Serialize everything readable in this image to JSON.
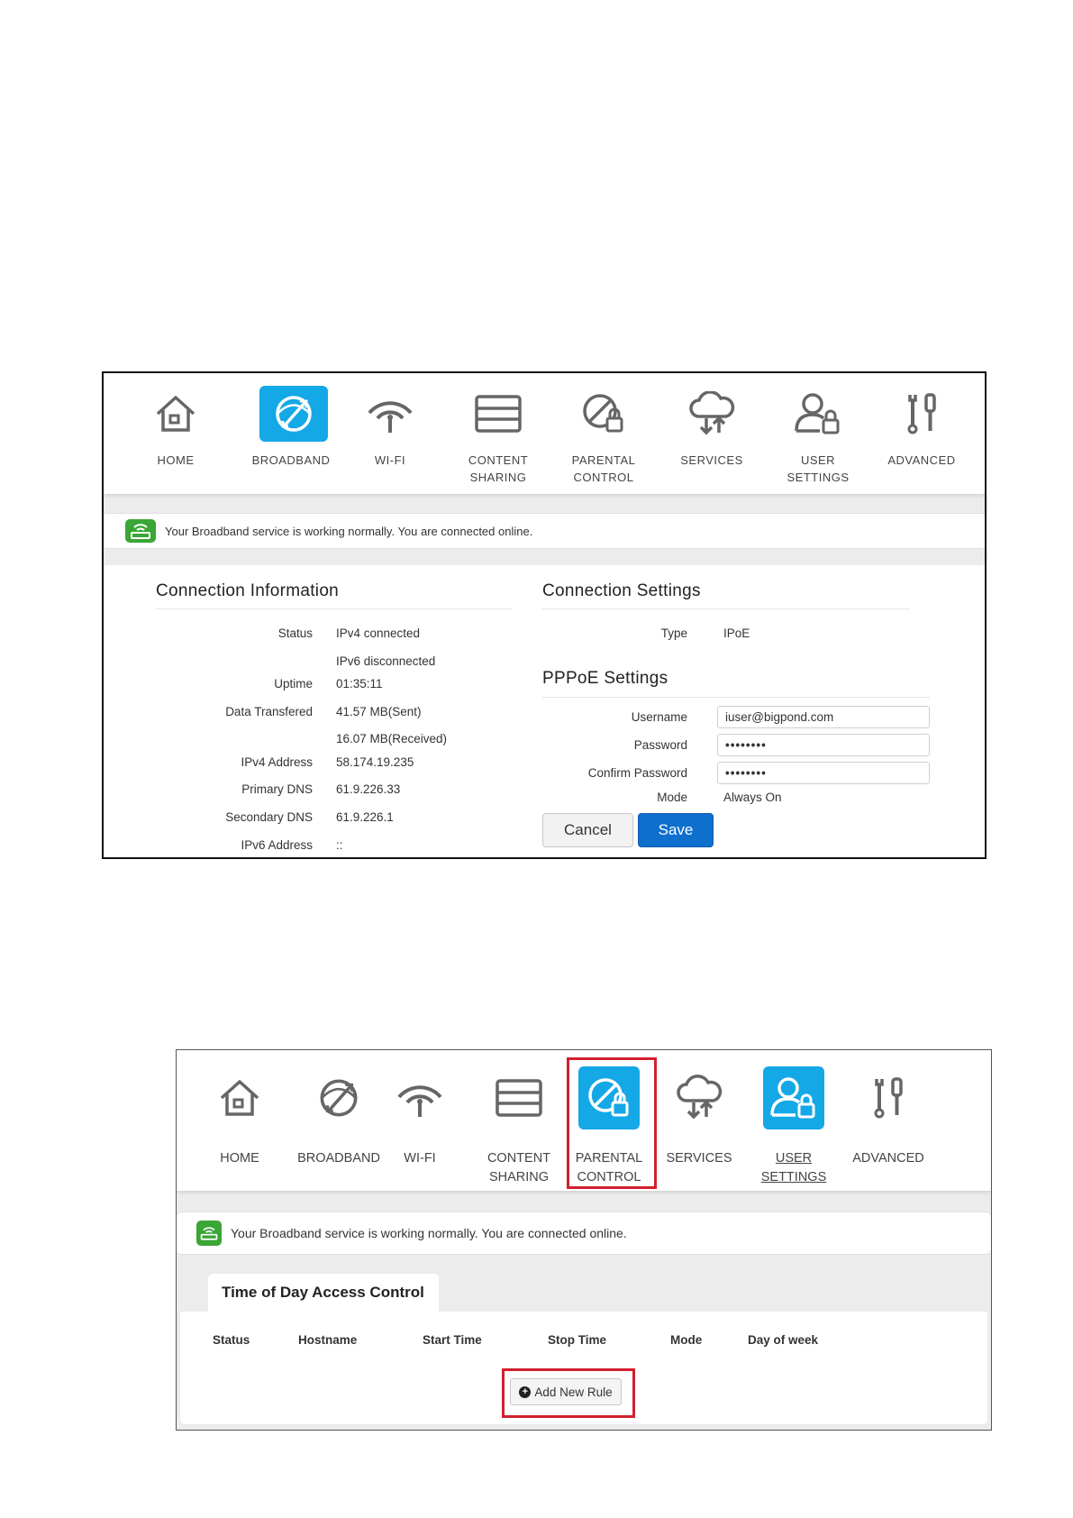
{
  "screen1": {
    "nav": [
      {
        "label": "HOME"
      },
      {
        "label": "BROADBAND"
      },
      {
        "label": "WI-FI"
      },
      {
        "label": "CONTENT\nSHARING"
      },
      {
        "label": "PARENTAL\nCONTROL"
      },
      {
        "label": "SERVICES"
      },
      {
        "label": "USER\nSETTINGS"
      },
      {
        "label": "ADVANCED"
      }
    ],
    "active_tab": "BROADBAND",
    "status_message": "Your Broadband service is working normally. You are connected online.",
    "connection_info": {
      "title": "Connection Information",
      "status_label": "Status",
      "status_ipv4": "IPv4 connected",
      "status_ipv6": "IPv6 disconnected",
      "uptime_label": "Uptime",
      "uptime": "01:35:11",
      "data_label": "Data Transfered",
      "data_sent": "41.57 MB(Sent)",
      "data_received": "16.07 MB(Received)",
      "ipv4_label": "IPv4 Address",
      "ipv4": "58.174.19.235",
      "pdns_label": "Primary DNS",
      "pdns": "61.9.226.33",
      "sdns_label": "Secondary DNS",
      "sdns": "61.9.226.1",
      "ipv6_label": "IPv6 Address",
      "ipv6": "::"
    },
    "connection_settings": {
      "title": "Connection Settings",
      "type_label": "Type",
      "type": "IPoE",
      "pppoe_title": "PPPoE Settings",
      "username_label": "Username",
      "username": "iuser@bigpond.com",
      "password_label": "Password",
      "password": "••••••••",
      "confirm_label": "Confirm Password",
      "confirm": "••••••••",
      "mode_label": "Mode",
      "mode": "Always On",
      "cancel": "Cancel",
      "save": "Save"
    }
  },
  "screen2": {
    "nav": [
      {
        "label": "HOME"
      },
      {
        "label": "BROADBAND"
      },
      {
        "label": "WI-FI"
      },
      {
        "label": "CONTENT\nSHARING"
      },
      {
        "label": "PARENTAL\nCONTROL"
      },
      {
        "label": "SERVICES"
      },
      {
        "label": "USER\nSETTINGS"
      },
      {
        "label": "ADVANCED"
      }
    ],
    "active_tabs": [
      "PARENTAL CONTROL",
      "USER SETTINGS"
    ],
    "highlighted": [
      "PARENTAL CONTROL",
      "Add New Rule"
    ],
    "status_message": "Your Broadband service is working normally. You are connected online.",
    "tab_title": "Time of Day Access Control",
    "columns": [
      "Status",
      "Hostname",
      "Start Time",
      "Stop Time",
      "Mode",
      "Day of week"
    ],
    "add_rule": "Add New Rule"
  },
  "colors": {
    "active_tile": "#14a8e6",
    "save_button": "#0f6fcd",
    "status_icon": "#3aa635",
    "highlight": "#d1202f"
  },
  "icons": [
    "home-icon",
    "broadband-globe-icon",
    "wifi-icon",
    "content-sharing-icon",
    "parental-lock-icon",
    "services-cloud-icon",
    "user-lock-icon",
    "advanced-tools-icon",
    "router-status-icon",
    "plus-circle-icon"
  ]
}
